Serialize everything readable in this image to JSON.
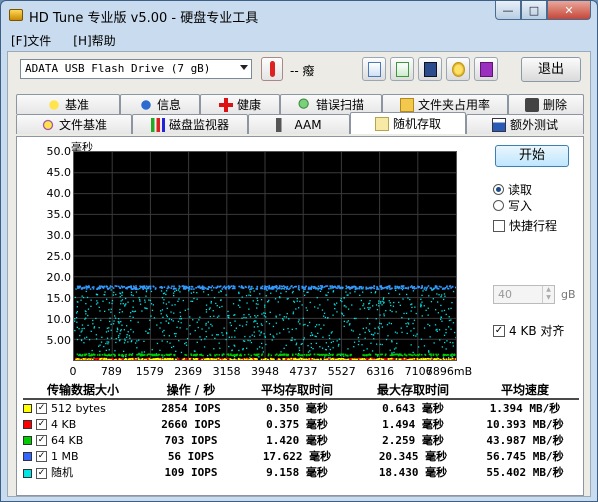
{
  "window": {
    "title": "HD Tune 专业版 v5.00 - 硬盘专业工具"
  },
  "menu": {
    "file": "[F]文件",
    "help": "[H]帮助"
  },
  "toolbar": {
    "drive": "ADATA   USB Flash Drive  (7 gB)",
    "temperature": "-- 癈",
    "exit": "退出"
  },
  "tabs_row1": [
    "基准",
    "信息",
    "健康",
    "错误扫描",
    "文件夹占用率",
    "删除"
  ],
  "tabs_row2": [
    "文件基准",
    "磁盘监视器",
    "AAM",
    "随机存取",
    "额外测试"
  ],
  "active_tab": "随机存取",
  "right_panel": {
    "start": "开始",
    "read": "读取",
    "write": "写入",
    "short_stroke": "快捷行程",
    "short_stroke_value": "40",
    "short_stroke_unit": "gB",
    "align_4kb": "4 KB 对齐"
  },
  "chart_data": {
    "type": "scatter",
    "ylabel": "毫秒",
    "ylim": [
      0,
      50
    ],
    "yticks": [
      "50.0",
      "45.0",
      "40.0",
      "35.0",
      "30.0",
      "25.0",
      "20.0",
      "15.0",
      "10.0",
      "5.00"
    ],
    "xlim": [
      0,
      7896
    ],
    "xticks": [
      "0",
      "789",
      "1579",
      "2369",
      "3158",
      "3948",
      "4737",
      "5527",
      "6316",
      "7106",
      "7896mB"
    ],
    "series": [
      {
        "name": "512 bytes",
        "color": "#ffff00",
        "approx_latency_ms": 0.35
      },
      {
        "name": "4 KB",
        "color": "#ff0000",
        "approx_latency_ms": 0.375
      },
      {
        "name": "64 KB",
        "color": "#00cc00",
        "approx_latency_ms": 1.42
      },
      {
        "name": "1 MB",
        "color": "#3399ff",
        "approx_latency_ms": 17.6
      },
      {
        "name": "随机",
        "color": "#00e5e5",
        "approx_latency_ms": 9.158
      }
    ]
  },
  "results": {
    "headers": [
      "传输数据大小",
      "操作 / 秒",
      "平均存取时间",
      "最大存取时间",
      "平均速度"
    ],
    "rows": [
      {
        "label": "512 bytes",
        "color": "#ffff00",
        "ops": "2854 IOPS",
        "avg": "0.350 毫秒",
        "max": "0.643 毫秒",
        "speed": "1.394 MB/秒"
      },
      {
        "label": "4 KB",
        "color": "#ff0000",
        "ops": "2660 IOPS",
        "avg": "0.375 毫秒",
        "max": "1.494 毫秒",
        "speed": "10.393 MB/秒"
      },
      {
        "label": "64 KB",
        "color": "#00cc00",
        "ops": "703 IOPS",
        "avg": "1.420 毫秒",
        "max": "2.259 毫秒",
        "speed": "43.987 MB/秒"
      },
      {
        "label": "1 MB",
        "color": "#3366ff",
        "ops": "56 IOPS",
        "avg": "17.622 毫秒",
        "max": "20.345 毫秒",
        "speed": "56.745 MB/秒"
      },
      {
        "label": "随机",
        "color": "#00e5e5",
        "ops": "109 IOPS",
        "avg": "9.158 毫秒",
        "max": "18.430 毫秒",
        "speed": "55.402 MB/秒"
      }
    ]
  }
}
